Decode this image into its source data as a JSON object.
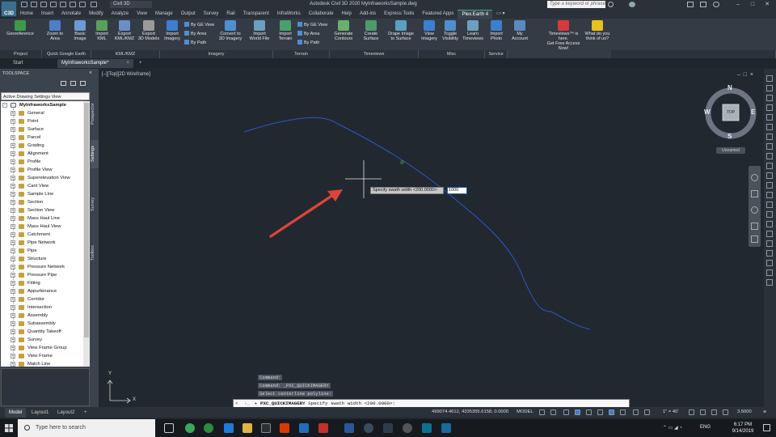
{
  "title_bar": {
    "workspace": "Civil 3D",
    "app_title": "Autodesk Civil 3D 2020    MyInfraworksSample.dwg",
    "search_placeholder": "Type a keyword or phrase",
    "user_name": "",
    "logo_text": "C3D",
    "window_controls": [
      "–",
      "□",
      "✕"
    ]
  },
  "ribbon_tabs": [
    "Home",
    "Insert",
    "Annotate",
    "Modify",
    "Analyze",
    "View",
    "Manage",
    "Output",
    "Survey",
    "Rail",
    "Transparent",
    "InfraWorks",
    "Collaborate",
    "Help",
    "Add-ins",
    "Express Tools",
    "Featured Apps",
    "Plex.Earth 4"
  ],
  "active_ribbon_tab": "Plex.Earth 4",
  "ribbon": {
    "buttons": [
      {
        "label": "Georeference",
        "sub": "",
        "icon": "globe-icon"
      },
      {
        "label": "Zoom to",
        "sub": "Area",
        "icon": "zoom-icon"
      },
      {
        "label": "Basic",
        "sub": "Image",
        "icon": "image-icon"
      },
      {
        "label": "Import",
        "sub": "KML",
        "icon": "kml-import-icon"
      },
      {
        "label": "Export",
        "sub": "KML/KMZ",
        "icon": "kml-export-icon"
      },
      {
        "label": "Export",
        "sub": "3D Models",
        "icon": "model-export-icon"
      },
      {
        "label": "Import",
        "sub": "Imagery",
        "icon": "imagery-import-icon"
      },
      {
        "label": "Convert to",
        "sub": "3D Imagery",
        "icon": "convert-3d-icon"
      },
      {
        "label": "Import",
        "sub": "World File",
        "icon": "world-file-icon"
      },
      {
        "label": "Import",
        "sub": "Terrain",
        "icon": "terrain-import-icon"
      },
      {
        "label": "Generate",
        "sub": "Contours",
        "icon": "contours-icon"
      },
      {
        "label": "Create",
        "sub": "Surface",
        "icon": "surface-icon"
      },
      {
        "label": "Drape Image",
        "sub": "to Surface",
        "icon": "drape-icon"
      },
      {
        "label": "View",
        "sub": "Imagery",
        "icon": "view-imagery-icon"
      },
      {
        "label": "Toggle",
        "sub": "Visibility",
        "icon": "toggle-visibility-icon"
      },
      {
        "label": "Learn",
        "sub": "Timeviews",
        "icon": "learn-icon"
      },
      {
        "label": "Import",
        "sub": "Photo",
        "icon": "photo-icon"
      },
      {
        "label": "My",
        "sub": "Account",
        "icon": "account-icon"
      },
      {
        "label": "Timeviews™ is here.",
        "sub": "Get Free Access Now!",
        "icon": "gift-icon"
      },
      {
        "label": "What do you",
        "sub": "think of us?",
        "icon": "star-icon"
      }
    ],
    "imagery_small": [
      "By GE View",
      "By Area",
      "By Path"
    ],
    "terrain_small": [
      "By GE View",
      "By Area",
      "By Path"
    ],
    "panels": [
      "Project",
      "Quick Google Earth",
      "KML/KMZ",
      "Imagery",
      "Terrain",
      "Timeviews",
      "Misc",
      "Service"
    ]
  },
  "file_tabs": {
    "start": "Start",
    "doc": "MyInfraworksSample*",
    "add": "+"
  },
  "toolspace": {
    "title": "TOOLSPACE",
    "view_select": "Active Drawing Settings View",
    "root": "MyInfraworksSample",
    "items": [
      "General",
      "Point",
      "Surface",
      "Parcel",
      "Grading",
      "Alignment",
      "Profile",
      "Profile View",
      "Superelevation View",
      "Cant View",
      "Sample Line",
      "Section",
      "Section View",
      "Mass Haul Line",
      "Mass Haul View",
      "Catchment",
      "Pipe Network",
      "Pipe",
      "Structure",
      "Pressure Network",
      "Pressure Pipe",
      "Fitting",
      "Appurtenance",
      "Corridor",
      "Intersection",
      "Assembly",
      "Subassembly",
      "Quantity Takeoff",
      "Survey",
      "View Frame Group",
      "View Frame",
      "Match Line"
    ],
    "side_tabs": [
      "Prospector",
      "Settings",
      "Survey",
      "Toolbox"
    ]
  },
  "viewport": {
    "label": "[–][Top][2D Wireframe]",
    "compass": {
      "n": "N",
      "s": "S",
      "e": "E",
      "w": "W",
      "top": "TOP"
    },
    "ucs_name": "Unnamed",
    "ucs_y": "Y",
    "ucs_x": "X",
    "dynamic_prompt": "Specify swath width <200.0000>:",
    "dynamic_value": "1000"
  },
  "command": {
    "history": [
      "Command:",
      "Command: _PXC_QUICKIMAGERY",
      "Select centerline polyline:"
    ],
    "prompt_cmd": "PXC_QUICKIMAGERY",
    "prompt_text": "Specify swath width <200.0000>:"
  },
  "layout_tabs": [
    "Model",
    "Layout1",
    "Layout2",
    "+"
  ],
  "status": {
    "coords": "499074.4612, 4335355.6158, 0.0000",
    "model": "MODEL",
    "scale": "1\" = 40'",
    "zoom": "3.5000"
  },
  "taskbar": {
    "search_placeholder": "Type here to search",
    "lang": "ENG",
    "time": "6:17 PM",
    "date": "9/14/2019"
  },
  "colors": {
    "polyline": "#2f56c8",
    "annotation_arrow": "#d9453a",
    "canvas": "#212830"
  }
}
